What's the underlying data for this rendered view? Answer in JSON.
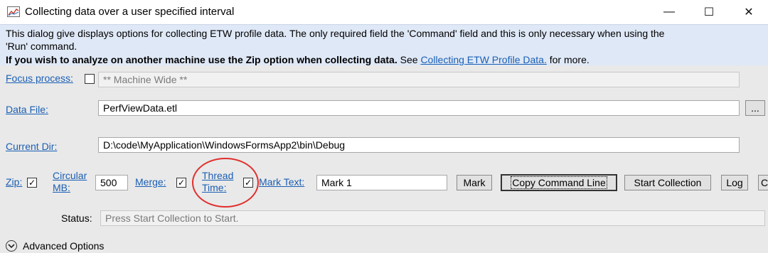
{
  "window": {
    "title": "Collecting data over a user specified interval",
    "minimize": "—",
    "maximize": "☐",
    "close": "✕"
  },
  "info": {
    "line1": "This dialog give displays options for collecting ETW profile data. The only required field the 'Command' field and this is only necessary when using the",
    "line2": "'Run' command.",
    "line3_bold": "If you wish to analyze on another machine use the Zip option when collecting data.",
    "line3_see": " See ",
    "line3_link": "Collecting ETW Profile Data.",
    "line3_end": " for more."
  },
  "form": {
    "focus_process": {
      "label": "Focus process:",
      "checked": false,
      "value": "** Machine Wide **"
    },
    "data_file": {
      "label": "Data File:",
      "value": "PerfViewData.etl",
      "browse_label": "..."
    },
    "current_dir": {
      "label": "Current Dir:",
      "value": "D:\\code\\MyApplication\\WindowsFormsApp2\\bin\\Debug"
    },
    "zip": {
      "label": "Zip:",
      "checked": "✓"
    },
    "circular": {
      "label_line1": "Circular",
      "label_line2": "MB:",
      "value": "500"
    },
    "merge": {
      "label": "Merge:",
      "checked": "✓"
    },
    "thread_time": {
      "label_line1": "Thread",
      "label_line2": "Time:",
      "checked": "✓"
    },
    "mark_text": {
      "label": "Mark Text:",
      "value": "Mark 1"
    },
    "buttons": {
      "mark": "Mark",
      "copy_command_line": "Copy Command Line",
      "start_collection": "Start Collection",
      "log": "Log",
      "cut_off": "C"
    },
    "status": {
      "label": "Status:",
      "value": "Press Start Collection to Start."
    }
  },
  "advanced": {
    "label": "Advanced Options"
  },
  "colors": {
    "info_bg": "#dfe8f6",
    "panel_bg": "#e9e9e9",
    "link": "#1a5fb4",
    "highlight_circle": "#e0302e"
  },
  "icons": [
    "app-chart-icon",
    "minimize-icon",
    "maximize-icon",
    "close-icon",
    "check-icon",
    "expand-chevron-icon"
  ]
}
